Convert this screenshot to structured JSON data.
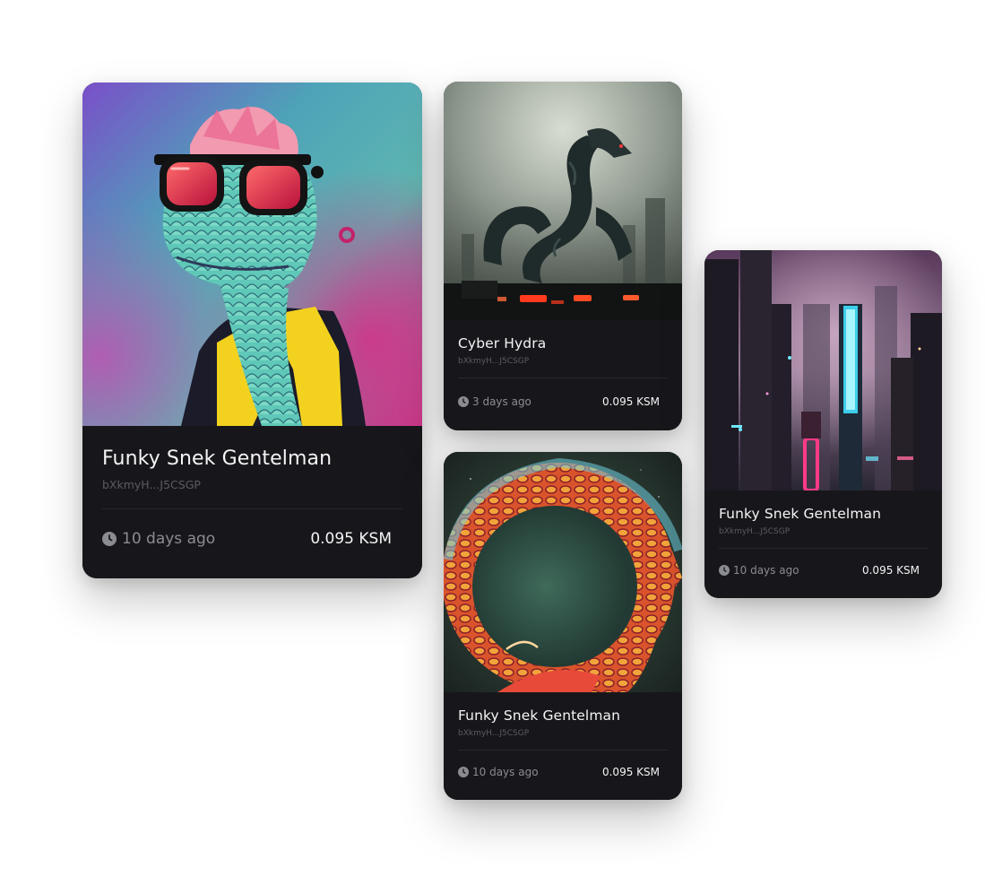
{
  "cards": [
    {
      "title": "Funky Snek Gentelman",
      "owner": "bXkmyH...J5CSGP",
      "age": "10 days ago",
      "price": "0.095 KSM",
      "artwork": "snake-in-sunglasses-and-yellow-jacket"
    },
    {
      "title": "Cyber Hydra",
      "owner": "bXkmyH...J5CSGP",
      "age": "3 days ago",
      "price": "0.095 KSM",
      "artwork": "mechanical-hydra-over-neon-city"
    },
    {
      "title": "Funky Snek Gentelman",
      "owner": "bXkmyH...J5CSGP",
      "age": "10 days ago",
      "price": "0.095 KSM",
      "artwork": "colorful-coiled-serpent"
    },
    {
      "title": "Funky Snek Gentelman",
      "owner": "bXkmyH...J5CSGP",
      "age": "10 days ago",
      "price": "0.095 KSM",
      "artwork": "neon-cyberpunk-city-towers"
    }
  ],
  "icons": {
    "age": "clock-icon"
  },
  "colors": {
    "card_background": "#17171b",
    "title_text": "#f4f4f6",
    "owner_text": "#5a5a62",
    "age_text": "#8b8b92",
    "price_text": "#f4f4f6"
  }
}
